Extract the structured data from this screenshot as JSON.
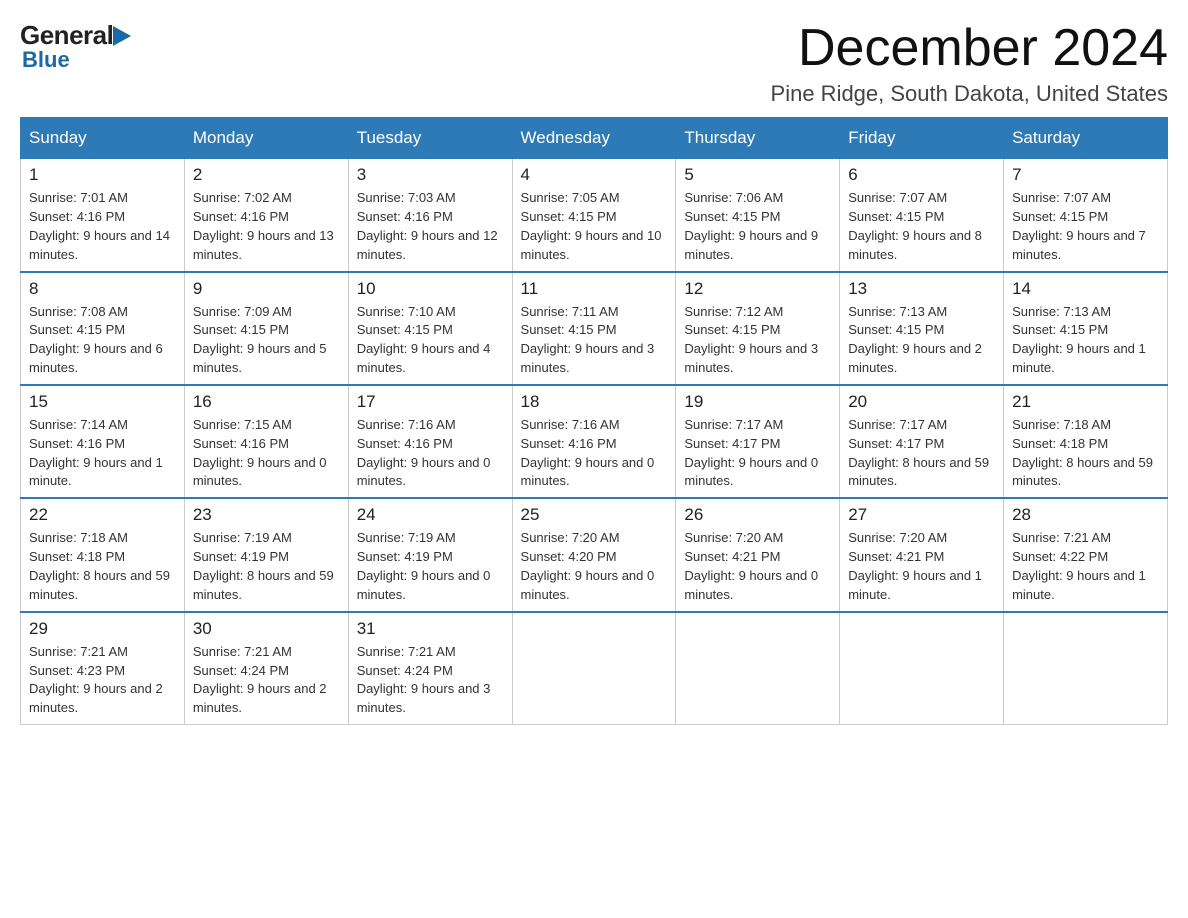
{
  "logo": {
    "general": "General",
    "blue": "Blue",
    "triangle_color": "#1a6aa8"
  },
  "title": "December 2024",
  "location": "Pine Ridge, South Dakota, United States",
  "days_of_week": [
    "Sunday",
    "Monday",
    "Tuesday",
    "Wednesday",
    "Thursday",
    "Friday",
    "Saturday"
  ],
  "weeks": [
    [
      {
        "day": "1",
        "sunrise": "7:01 AM",
        "sunset": "4:16 PM",
        "daylight": "9 hours and 14 minutes."
      },
      {
        "day": "2",
        "sunrise": "7:02 AM",
        "sunset": "4:16 PM",
        "daylight": "9 hours and 13 minutes."
      },
      {
        "day": "3",
        "sunrise": "7:03 AM",
        "sunset": "4:16 PM",
        "daylight": "9 hours and 12 minutes."
      },
      {
        "day": "4",
        "sunrise": "7:05 AM",
        "sunset": "4:15 PM",
        "daylight": "9 hours and 10 minutes."
      },
      {
        "day": "5",
        "sunrise": "7:06 AM",
        "sunset": "4:15 PM",
        "daylight": "9 hours and 9 minutes."
      },
      {
        "day": "6",
        "sunrise": "7:07 AM",
        "sunset": "4:15 PM",
        "daylight": "9 hours and 8 minutes."
      },
      {
        "day": "7",
        "sunrise": "7:07 AM",
        "sunset": "4:15 PM",
        "daylight": "9 hours and 7 minutes."
      }
    ],
    [
      {
        "day": "8",
        "sunrise": "7:08 AM",
        "sunset": "4:15 PM",
        "daylight": "9 hours and 6 minutes."
      },
      {
        "day": "9",
        "sunrise": "7:09 AM",
        "sunset": "4:15 PM",
        "daylight": "9 hours and 5 minutes."
      },
      {
        "day": "10",
        "sunrise": "7:10 AM",
        "sunset": "4:15 PM",
        "daylight": "9 hours and 4 minutes."
      },
      {
        "day": "11",
        "sunrise": "7:11 AM",
        "sunset": "4:15 PM",
        "daylight": "9 hours and 3 minutes."
      },
      {
        "day": "12",
        "sunrise": "7:12 AM",
        "sunset": "4:15 PM",
        "daylight": "9 hours and 3 minutes."
      },
      {
        "day": "13",
        "sunrise": "7:13 AM",
        "sunset": "4:15 PM",
        "daylight": "9 hours and 2 minutes."
      },
      {
        "day": "14",
        "sunrise": "7:13 AM",
        "sunset": "4:15 PM",
        "daylight": "9 hours and 1 minute."
      }
    ],
    [
      {
        "day": "15",
        "sunrise": "7:14 AM",
        "sunset": "4:16 PM",
        "daylight": "9 hours and 1 minute."
      },
      {
        "day": "16",
        "sunrise": "7:15 AM",
        "sunset": "4:16 PM",
        "daylight": "9 hours and 0 minutes."
      },
      {
        "day": "17",
        "sunrise": "7:16 AM",
        "sunset": "4:16 PM",
        "daylight": "9 hours and 0 minutes."
      },
      {
        "day": "18",
        "sunrise": "7:16 AM",
        "sunset": "4:16 PM",
        "daylight": "9 hours and 0 minutes."
      },
      {
        "day": "19",
        "sunrise": "7:17 AM",
        "sunset": "4:17 PM",
        "daylight": "9 hours and 0 minutes."
      },
      {
        "day": "20",
        "sunrise": "7:17 AM",
        "sunset": "4:17 PM",
        "daylight": "8 hours and 59 minutes."
      },
      {
        "day": "21",
        "sunrise": "7:18 AM",
        "sunset": "4:18 PM",
        "daylight": "8 hours and 59 minutes."
      }
    ],
    [
      {
        "day": "22",
        "sunrise": "7:18 AM",
        "sunset": "4:18 PM",
        "daylight": "8 hours and 59 minutes."
      },
      {
        "day": "23",
        "sunrise": "7:19 AM",
        "sunset": "4:19 PM",
        "daylight": "8 hours and 59 minutes."
      },
      {
        "day": "24",
        "sunrise": "7:19 AM",
        "sunset": "4:19 PM",
        "daylight": "9 hours and 0 minutes."
      },
      {
        "day": "25",
        "sunrise": "7:20 AM",
        "sunset": "4:20 PM",
        "daylight": "9 hours and 0 minutes."
      },
      {
        "day": "26",
        "sunrise": "7:20 AM",
        "sunset": "4:21 PM",
        "daylight": "9 hours and 0 minutes."
      },
      {
        "day": "27",
        "sunrise": "7:20 AM",
        "sunset": "4:21 PM",
        "daylight": "9 hours and 1 minute."
      },
      {
        "day": "28",
        "sunrise": "7:21 AM",
        "sunset": "4:22 PM",
        "daylight": "9 hours and 1 minute."
      }
    ],
    [
      {
        "day": "29",
        "sunrise": "7:21 AM",
        "sunset": "4:23 PM",
        "daylight": "9 hours and 2 minutes."
      },
      {
        "day": "30",
        "sunrise": "7:21 AM",
        "sunset": "4:24 PM",
        "daylight": "9 hours and 2 minutes."
      },
      {
        "day": "31",
        "sunrise": "7:21 AM",
        "sunset": "4:24 PM",
        "daylight": "9 hours and 3 minutes."
      },
      null,
      null,
      null,
      null
    ]
  ],
  "labels": {
    "sunrise": "Sunrise:",
    "sunset": "Sunset:",
    "daylight": "Daylight:"
  }
}
